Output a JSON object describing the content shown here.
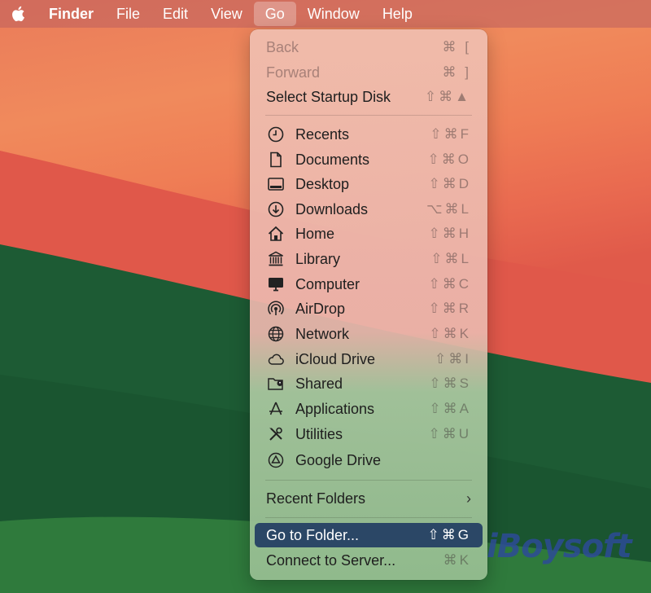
{
  "menubar": {
    "apple_icon": "apple-logo-icon",
    "items": [
      {
        "label": "Finder"
      },
      {
        "label": "File"
      },
      {
        "label": "Edit"
      },
      {
        "label": "View"
      },
      {
        "label": "Go"
      },
      {
        "label": "Window"
      },
      {
        "label": "Help"
      }
    ],
    "active_item": "Go"
  },
  "go_menu": {
    "section1": [
      {
        "label": "Back",
        "shortcut": "⌘ [",
        "enabled": false
      },
      {
        "label": "Forward",
        "shortcut": "⌘ ]",
        "enabled": false
      },
      {
        "label": "Select Startup Disk",
        "shortcut": "⇧⌘▲",
        "enabled": true
      }
    ],
    "section2": [
      {
        "label": "Recents",
        "shortcut": "⇧⌘F",
        "icon": "clock-icon"
      },
      {
        "label": "Documents",
        "shortcut": "⇧⌘O",
        "icon": "document-icon"
      },
      {
        "label": "Desktop",
        "shortcut": "⇧⌘D",
        "icon": "desktop-icon"
      },
      {
        "label": "Downloads",
        "shortcut": "⌥⌘L",
        "icon": "download-icon"
      },
      {
        "label": "Home",
        "shortcut": "⇧⌘H",
        "icon": "home-icon"
      },
      {
        "label": "Library",
        "shortcut": "⇧⌘L",
        "icon": "library-icon"
      },
      {
        "label": "Computer",
        "shortcut": "⇧⌘C",
        "icon": "computer-icon"
      },
      {
        "label": "AirDrop",
        "shortcut": "⇧⌘R",
        "icon": "airdrop-icon"
      },
      {
        "label": "Network",
        "shortcut": "⇧⌘K",
        "icon": "network-icon"
      },
      {
        "label": "iCloud Drive",
        "shortcut": "⇧⌘I",
        "icon": "cloud-icon"
      },
      {
        "label": "Shared",
        "shortcut": "⇧⌘S",
        "icon": "shared-folder-icon"
      },
      {
        "label": "Applications",
        "shortcut": "⇧⌘A",
        "icon": "applications-icon"
      },
      {
        "label": "Utilities",
        "shortcut": "⇧⌘U",
        "icon": "utilities-icon"
      },
      {
        "label": "Google Drive",
        "shortcut": "",
        "icon": "google-drive-icon"
      }
    ],
    "recent_folders": {
      "label": "Recent Folders",
      "submenu_indicator": "›"
    },
    "section4": [
      {
        "label": "Go to Folder...",
        "shortcut": "⇧⌘G",
        "highlighted": true
      },
      {
        "label": "Connect to Server...",
        "shortcut": "⌘K",
        "highlighted": false
      }
    ]
  },
  "watermark": {
    "text": "iBoysoft"
  },
  "colors": {
    "highlight": "#2b4766",
    "menubar_text": "#ffffff"
  }
}
